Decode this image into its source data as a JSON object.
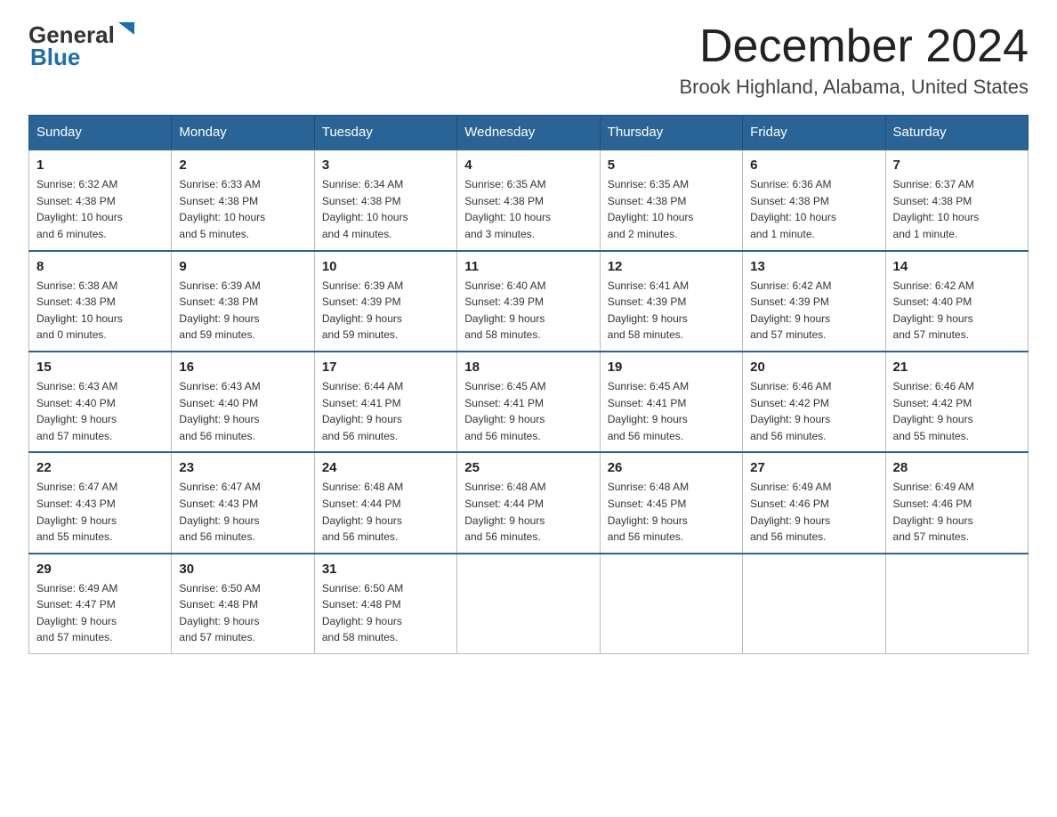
{
  "logo": {
    "general": "General",
    "blue": "Blue"
  },
  "header": {
    "month": "December 2024",
    "location": "Brook Highland, Alabama, United States"
  },
  "weekdays": [
    "Sunday",
    "Monday",
    "Tuesday",
    "Wednesday",
    "Thursday",
    "Friday",
    "Saturday"
  ],
  "weeks": [
    [
      {
        "day": "1",
        "sunrise": "6:32 AM",
        "sunset": "4:38 PM",
        "daylight": "10 hours and 6 minutes."
      },
      {
        "day": "2",
        "sunrise": "6:33 AM",
        "sunset": "4:38 PM",
        "daylight": "10 hours and 5 minutes."
      },
      {
        "day": "3",
        "sunrise": "6:34 AM",
        "sunset": "4:38 PM",
        "daylight": "10 hours and 4 minutes."
      },
      {
        "day": "4",
        "sunrise": "6:35 AM",
        "sunset": "4:38 PM",
        "daylight": "10 hours and 3 minutes."
      },
      {
        "day": "5",
        "sunrise": "6:35 AM",
        "sunset": "4:38 PM",
        "daylight": "10 hours and 2 minutes."
      },
      {
        "day": "6",
        "sunrise": "6:36 AM",
        "sunset": "4:38 PM",
        "daylight": "10 hours and 1 minute."
      },
      {
        "day": "7",
        "sunrise": "6:37 AM",
        "sunset": "4:38 PM",
        "daylight": "10 hours and 1 minute."
      }
    ],
    [
      {
        "day": "8",
        "sunrise": "6:38 AM",
        "sunset": "4:38 PM",
        "daylight": "10 hours and 0 minutes."
      },
      {
        "day": "9",
        "sunrise": "6:39 AM",
        "sunset": "4:38 PM",
        "daylight": "9 hours and 59 minutes."
      },
      {
        "day": "10",
        "sunrise": "6:39 AM",
        "sunset": "4:39 PM",
        "daylight": "9 hours and 59 minutes."
      },
      {
        "day": "11",
        "sunrise": "6:40 AM",
        "sunset": "4:39 PM",
        "daylight": "9 hours and 58 minutes."
      },
      {
        "day": "12",
        "sunrise": "6:41 AM",
        "sunset": "4:39 PM",
        "daylight": "9 hours and 58 minutes."
      },
      {
        "day": "13",
        "sunrise": "6:42 AM",
        "sunset": "4:39 PM",
        "daylight": "9 hours and 57 minutes."
      },
      {
        "day": "14",
        "sunrise": "6:42 AM",
        "sunset": "4:40 PM",
        "daylight": "9 hours and 57 minutes."
      }
    ],
    [
      {
        "day": "15",
        "sunrise": "6:43 AM",
        "sunset": "4:40 PM",
        "daylight": "9 hours and 57 minutes."
      },
      {
        "day": "16",
        "sunrise": "6:43 AM",
        "sunset": "4:40 PM",
        "daylight": "9 hours and 56 minutes."
      },
      {
        "day": "17",
        "sunrise": "6:44 AM",
        "sunset": "4:41 PM",
        "daylight": "9 hours and 56 minutes."
      },
      {
        "day": "18",
        "sunrise": "6:45 AM",
        "sunset": "4:41 PM",
        "daylight": "9 hours and 56 minutes."
      },
      {
        "day": "19",
        "sunrise": "6:45 AM",
        "sunset": "4:41 PM",
        "daylight": "9 hours and 56 minutes."
      },
      {
        "day": "20",
        "sunrise": "6:46 AM",
        "sunset": "4:42 PM",
        "daylight": "9 hours and 56 minutes."
      },
      {
        "day": "21",
        "sunrise": "6:46 AM",
        "sunset": "4:42 PM",
        "daylight": "9 hours and 55 minutes."
      }
    ],
    [
      {
        "day": "22",
        "sunrise": "6:47 AM",
        "sunset": "4:43 PM",
        "daylight": "9 hours and 55 minutes."
      },
      {
        "day": "23",
        "sunrise": "6:47 AM",
        "sunset": "4:43 PM",
        "daylight": "9 hours and 56 minutes."
      },
      {
        "day": "24",
        "sunrise": "6:48 AM",
        "sunset": "4:44 PM",
        "daylight": "9 hours and 56 minutes."
      },
      {
        "day": "25",
        "sunrise": "6:48 AM",
        "sunset": "4:44 PM",
        "daylight": "9 hours and 56 minutes."
      },
      {
        "day": "26",
        "sunrise": "6:48 AM",
        "sunset": "4:45 PM",
        "daylight": "9 hours and 56 minutes."
      },
      {
        "day": "27",
        "sunrise": "6:49 AM",
        "sunset": "4:46 PM",
        "daylight": "9 hours and 56 minutes."
      },
      {
        "day": "28",
        "sunrise": "6:49 AM",
        "sunset": "4:46 PM",
        "daylight": "9 hours and 57 minutes."
      }
    ],
    [
      {
        "day": "29",
        "sunrise": "6:49 AM",
        "sunset": "4:47 PM",
        "daylight": "9 hours and 57 minutes."
      },
      {
        "day": "30",
        "sunrise": "6:50 AM",
        "sunset": "4:48 PM",
        "daylight": "9 hours and 57 minutes."
      },
      {
        "day": "31",
        "sunrise": "6:50 AM",
        "sunset": "4:48 PM",
        "daylight": "9 hours and 58 minutes."
      },
      null,
      null,
      null,
      null
    ]
  ],
  "labels": {
    "sunrise": "Sunrise:",
    "sunset": "Sunset:",
    "daylight": "Daylight:"
  }
}
